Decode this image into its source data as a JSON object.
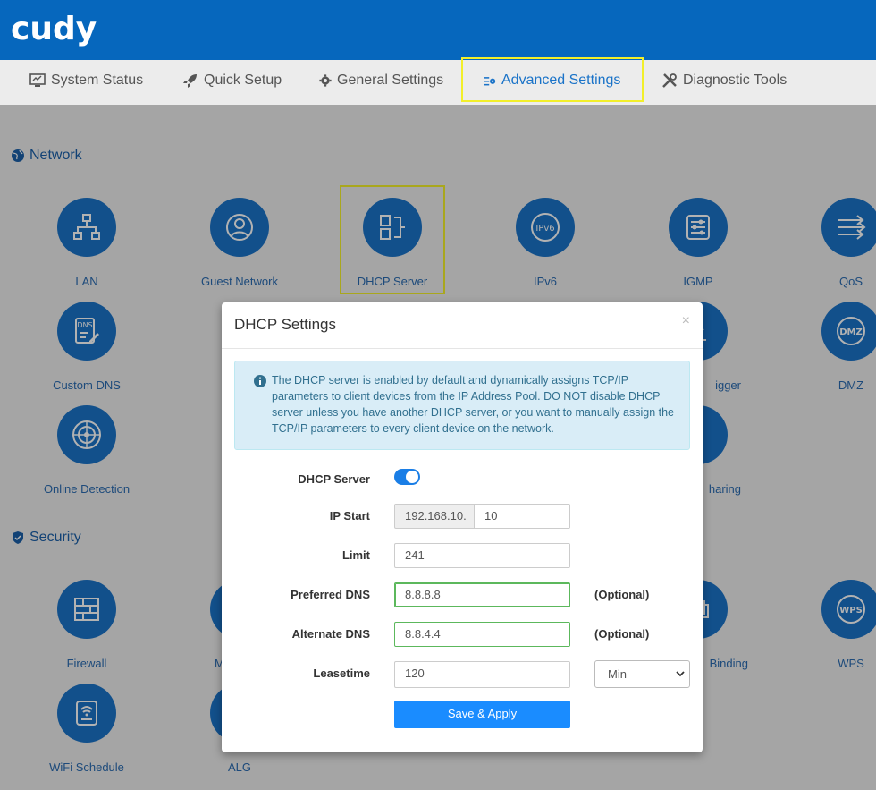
{
  "brand": {
    "logo": "cudy"
  },
  "nav": {
    "items": [
      {
        "label": "System Status",
        "icon": "monitor-icon"
      },
      {
        "label": "Quick Setup",
        "icon": "rocket-icon"
      },
      {
        "label": "General Settings",
        "icon": "gear-icon"
      },
      {
        "label": "Advanced Settings",
        "icon": "advanced-settings-icon"
      },
      {
        "label": "Diagnostic Tools",
        "icon": "tools-icon"
      }
    ],
    "active": "Advanced Settings"
  },
  "sections": {
    "network": {
      "title": "Network",
      "icon": "globe-icon"
    },
    "security": {
      "title": "Security",
      "icon": "shield-icon"
    }
  },
  "tiles": {
    "lan": "LAN",
    "guest_network": "Guest Network",
    "dhcp_server": "DHCP Server",
    "ipv6": "IPv6",
    "igmp": "IGMP",
    "qos": "QoS",
    "custom_dns": "Custom DNS",
    "port_trigger_partial": "igger",
    "dmz": "DMZ",
    "online_detection": "Online Detection",
    "sharing_partial": "haring",
    "firewall": "Firewall",
    "mac_partial": "M",
    "binding_partial": "Binding",
    "wps": "WPS",
    "wifi_schedule": "WiFi Schedule",
    "alg": "ALG"
  },
  "modal": {
    "title": "DHCP Settings",
    "close": "×",
    "info": "The DHCP server is enabled by default and dynamically assigns TCP/IP parameters to client devices from the IP Address Pool. DO NOT disable DHCP server unless you have another DHCP server, or you want to manually assign the TCP/IP parameters to every client device on the network.",
    "fields": {
      "dhcp_server": {
        "label": "DHCP Server",
        "enabled": true
      },
      "ip_start": {
        "label": "IP Start",
        "prefix": "192.168.10.",
        "value": "10"
      },
      "limit": {
        "label": "Limit",
        "value": "241"
      },
      "preferred_dns": {
        "label": "Preferred DNS",
        "value": "8.8.8.8",
        "note": "(Optional)"
      },
      "alternate_dns": {
        "label": "Alternate DNS",
        "value": "8.8.4.4",
        "note": "(Optional)"
      },
      "leasetime": {
        "label": "Leasetime",
        "value": "120",
        "unit": "Min"
      }
    },
    "save_label": "Save & Apply"
  },
  "colors": {
    "header": "#0667bd",
    "accent": "#1a73c8",
    "highlight": "#f2ef2a",
    "button": "#1a8cff"
  }
}
